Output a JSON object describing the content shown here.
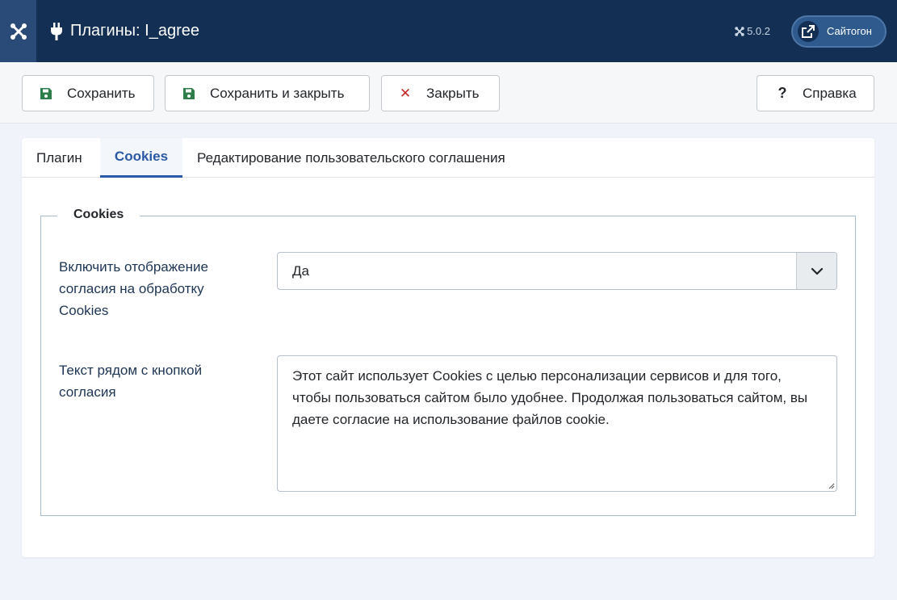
{
  "header": {
    "title": "Плагины: I_agree",
    "version": "5.0.2",
    "site_button_label": "Сайтогон"
  },
  "toolbar": {
    "save_label": "Сохранить",
    "save_close_label": "Сохранить и закрыть",
    "close_label": "Закрыть",
    "help_label": "Справка",
    "help_glyph": "?",
    "close_glyph": "✕"
  },
  "tabs": [
    {
      "label": "Плагин"
    },
    {
      "label": "Cookies"
    },
    {
      "label": "Редактирование пользовательского соглашения"
    }
  ],
  "active_tab": "Cookies",
  "fieldset": {
    "legend": "Cookies",
    "fields": [
      {
        "label_lines": [
          "Включить отображение",
          "согласия на обработку",
          "Cookies"
        ],
        "value": "Да"
      },
      {
        "label_lines": [
          "Текст рядом с кнопкой",
          "согласия"
        ],
        "value": "Этот сайт использует Cookies с целью персонализации сервисов и для того, чтобы пользоваться сайтом было удобнее. Продолжая пользоваться сайтом, вы даете согласие на использование файлов cookie."
      }
    ]
  },
  "colors": {
    "header_bg": "#132f53",
    "accent": "#2a5aa6",
    "save_icon": "#2f7d4a",
    "close_icon": "#c62828"
  }
}
